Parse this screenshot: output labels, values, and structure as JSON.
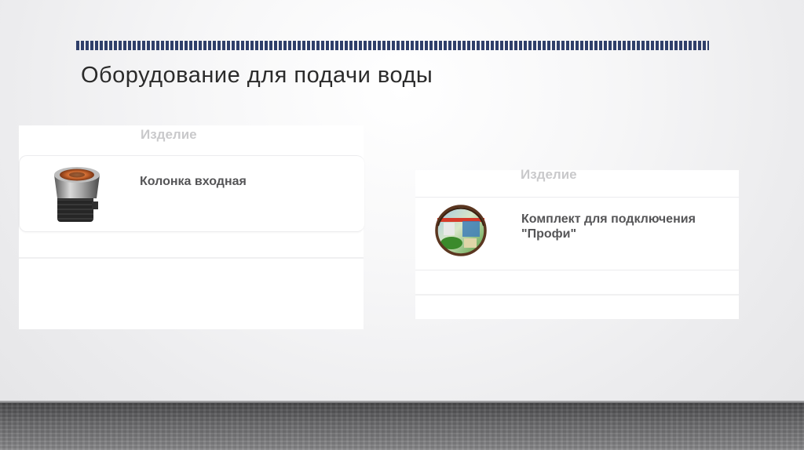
{
  "slide": {
    "title": "Оборудование для подачи воды",
    "colors": {
      "dash_bar": "#2f3f6a",
      "title_text": "#2b2b2b",
      "header_text": "#c9c9cb",
      "item_text": "#555557"
    }
  },
  "tables": [
    {
      "header": "Изделие",
      "items": [
        {
          "name": "Колонка входная",
          "icon": "water-column-fitting-icon"
        }
      ]
    },
    {
      "header": "Изделие",
      "items": [
        {
          "name_line1": "Комплект для подключения",
          "name_line2": "\"Профи\"",
          "icon": "hose-connection-kit-icon"
        }
      ]
    }
  ]
}
